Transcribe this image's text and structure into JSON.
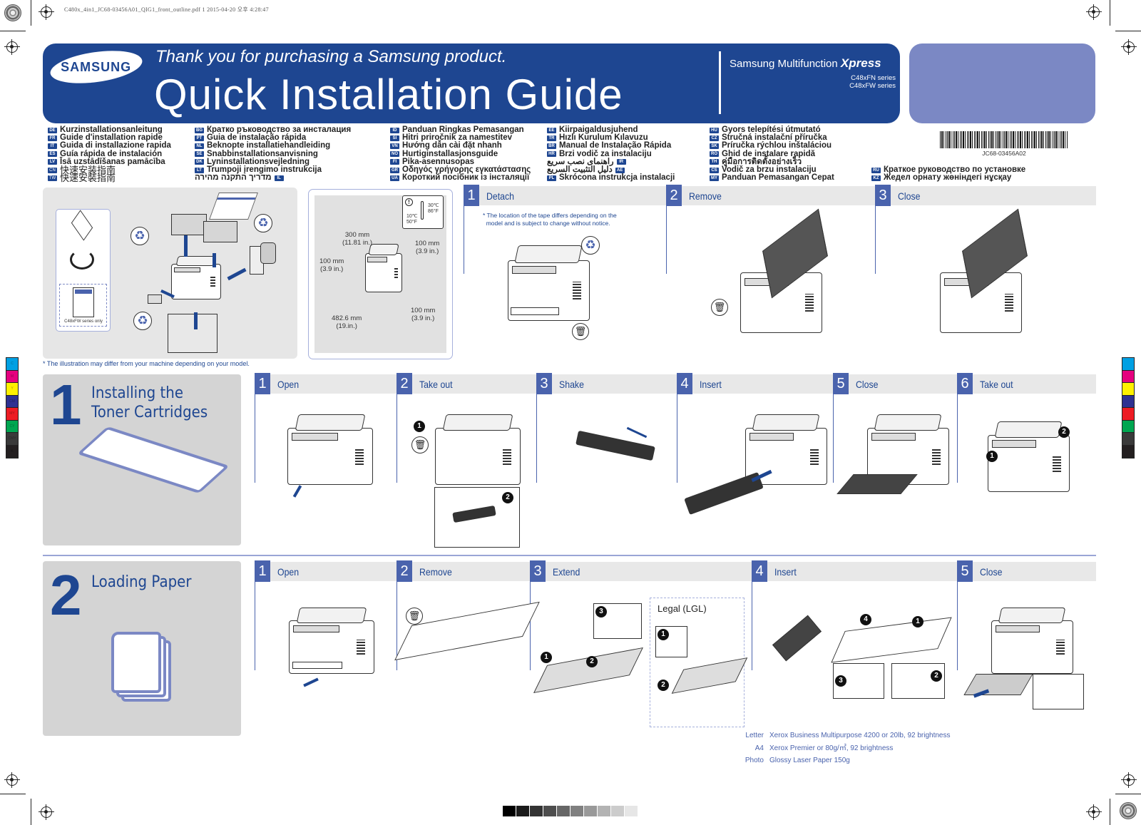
{
  "print_marks": {
    "file_header": "C480x_4in1_JC68-03456A01_QIG1_front_outline.pdf   1   2015-04-20   오후 4:28:47",
    "color_patches": [
      "#00a0e3",
      "#e5007e",
      "#fff100",
      "#2e3192",
      "#ed1c24",
      "#00a651",
      "#3a3a3a",
      "#231f20"
    ],
    "color_patch_labels": [
      "C",
      "M",
      "Y",
      "CM",
      "MY",
      "CY",
      "CMY",
      "K"
    ],
    "gray_scale": [
      "#000000",
      "#1a1a1a",
      "#333333",
      "#4d4d4d",
      "#666666",
      "#808080",
      "#999999",
      "#b3b3b3",
      "#cccccc",
      "#e6e6e6"
    ]
  },
  "colors": {
    "brand_blue": "#1e4691",
    "step_blue": "#4a63ad",
    "accent_lavender": "#7b88c4",
    "panel_gray": "#d4d4d4"
  },
  "header": {
    "logo": "SAMSUNG",
    "thanks": "Thank you for purchasing a Samsung product.",
    "title": "Quick Installation Guide",
    "product_line": "Samsung Multifunction",
    "product_brand": "Xpress",
    "series": [
      "C48xFN series",
      "C48xFW series"
    ]
  },
  "languages": {
    "col1": [
      {
        "code": "DE",
        "text": "Kurzinstallationsanleitung"
      },
      {
        "code": "FR",
        "text": "Guide d'installation rapide"
      },
      {
        "code": "IT",
        "text": "Guida di installazione rapida"
      },
      {
        "code": "ES",
        "text": "Guía rápida de instalación"
      },
      {
        "code": "LV",
        "text": "Īsā uzstādīšanas pamācība"
      },
      {
        "code": "CN",
        "text": "快速安装指南"
      },
      {
        "code": "TW",
        "text": "快速安裝指南"
      }
    ],
    "col2": [
      {
        "code": "BG",
        "text": "Кратко ръководство за инсталация"
      },
      {
        "code": "PT",
        "text": "Guia de instalação rápida"
      },
      {
        "code": "NL",
        "text": "Beknopte installatiehandleiding"
      },
      {
        "code": "SE",
        "text": "Snabbinstallationsanvisning"
      },
      {
        "code": "DK",
        "text": "Lyninstallationsvejledning"
      },
      {
        "code": "LT",
        "text": "Trumpoji įrengimo instrukcija"
      },
      {
        "code": "IL",
        "text": "מדריך התקנה מהירה"
      }
    ],
    "col3": [
      {
        "code": "ID",
        "text": "Panduan Ringkas Pemasangan"
      },
      {
        "code": "SI",
        "text": "Hitri priročnik za namestitev"
      },
      {
        "code": "VN",
        "text": "Hướng dẫn cài đặt nhanh"
      },
      {
        "code": "NO",
        "text": "Hurtiginstallasjonsguide"
      },
      {
        "code": "FI",
        "text": "Pika-asennusopas"
      },
      {
        "code": "GR",
        "text": "Οδηγός γρήγορης εγκατάστασης"
      },
      {
        "code": "UA",
        "text": "Короткий посібник із інсталяції"
      }
    ],
    "col4": [
      {
        "code": "EE",
        "text": "Kiirpaigaldusjuhend"
      },
      {
        "code": "TR",
        "text": "Hızlı Kurulum Kılavuzu"
      },
      {
        "code": "BR",
        "text": "Manual de Instalação Rápida"
      },
      {
        "code": "HR",
        "text": "Brzi vodič za instalaciju"
      },
      {
        "code": "IR",
        "text": "راهنمای نصب سریع"
      },
      {
        "code": "AE",
        "text": "دليل التثبيت السريع"
      },
      {
        "code": "PL",
        "text": "Skrócona instrukcja instalacji"
      }
    ],
    "col5": [
      {
        "code": "HU",
        "text": "Gyors telepítési útmutató"
      },
      {
        "code": "CZ",
        "text": "Stručná instalační příručka"
      },
      {
        "code": "SK",
        "text": "Príručka rýchlou inštaláciou"
      },
      {
        "code": "RO",
        "text": "Ghid de instalare rapidă"
      },
      {
        "code": "TH",
        "text": "คู่มือการติดตั้งอย่างเร็ว"
      },
      {
        "code": "CS",
        "text": "Vodič za brzu instalaciju"
      },
      {
        "code": "MY",
        "text": "Panduan Pemasangan Cepat"
      }
    ],
    "col6": [
      {
        "code": "RU",
        "text": "Краткое руководство по установке"
      },
      {
        "code": "KZ",
        "text": "Жедел орнату жөніндегі нұсқау"
      }
    ]
  },
  "barcode": {
    "text": "JC68-03456A02"
  },
  "unpacking": {
    "fw_only": "C48xFW series only",
    "disclaimer": "* The illustration may differ from your machine depending on your model."
  },
  "clearance": {
    "top": "300 mm\n(11.81 in.)",
    "left": "100 mm\n(3.9 in.)",
    "right": "100 mm\n(3.9 in.)",
    "back_right": "100 mm\n(3.9 in.)",
    "front": "482.6 mm\n(19.in.)",
    "temp_high_c": "30℃",
    "temp_high_f": "86°F",
    "temp_low_c": "10℃",
    "temp_low_f": "50°F"
  },
  "setup_steps": {
    "note": "* The location of the tape differs depending on the\n  model and is subject to change without notice.",
    "steps": [
      {
        "num": "1",
        "label": "Detach"
      },
      {
        "num": "2",
        "label": "Remove"
      },
      {
        "num": "3",
        "label": "Close"
      }
    ]
  },
  "section1": {
    "number": "1",
    "title": "Installing the\nToner Cartridges",
    "steps": [
      {
        "num": "1",
        "label": "Open"
      },
      {
        "num": "2",
        "label": "Take out"
      },
      {
        "num": "3",
        "label": "Shake"
      },
      {
        "num": "4",
        "label": "Insert"
      },
      {
        "num": "5",
        "label": "Close"
      },
      {
        "num": "6",
        "label": "Take out"
      }
    ]
  },
  "section2": {
    "number": "2",
    "title": "Loading Paper",
    "steps": [
      {
        "num": "1",
        "label": "Open"
      },
      {
        "num": "2",
        "label": "Remove"
      },
      {
        "num": "3",
        "label": "Extend"
      },
      {
        "num": "4",
        "label": "Insert"
      },
      {
        "num": "5",
        "label": "Close"
      }
    ],
    "legal_label": "Legal (LGL)",
    "paper_specs": [
      {
        "size": "Letter",
        "spec": "Xerox Business Multipurpose 4200 or 20lb, 92 brightness"
      },
      {
        "size": "A4",
        "spec": "Xerox Premier or 80g/㎡, 92 brightness"
      },
      {
        "size": "Photo",
        "spec": "Glossy Laser Paper 150g"
      }
    ]
  }
}
